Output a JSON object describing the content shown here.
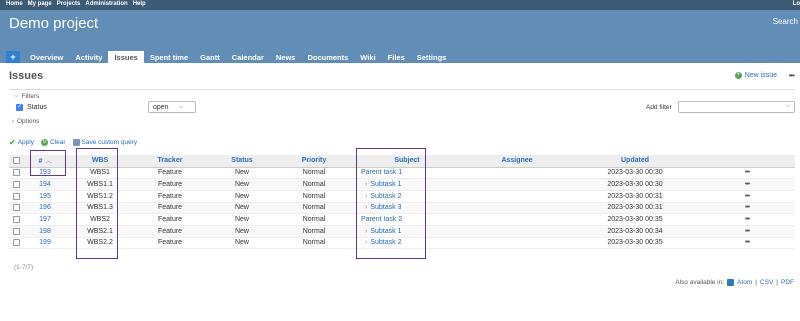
{
  "top_menu": {
    "items": [
      "Home",
      "My page",
      "Projects",
      "Administration",
      "Help"
    ],
    "right": "Lo"
  },
  "header": {
    "title": "Demo project",
    "search_label": "Search"
  },
  "tabs": [
    {
      "label": "+"
    },
    {
      "label": "Overview"
    },
    {
      "label": "Activity"
    },
    {
      "label": "Issues",
      "selected": true
    },
    {
      "label": "Spent time"
    },
    {
      "label": "Gantt"
    },
    {
      "label": "Calendar"
    },
    {
      "label": "News"
    },
    {
      "label": "Documents"
    },
    {
      "label": "Wiki"
    },
    {
      "label": "Files"
    },
    {
      "label": "Settings"
    }
  ],
  "page": {
    "title": "Issues",
    "new_issue": "New issue",
    "more": "•••"
  },
  "filters": {
    "legend": "Filters",
    "status_label": "Status",
    "status_value": "open",
    "add_filter_label": "Add filter",
    "options_legend": "Options"
  },
  "actions": {
    "apply": "Apply",
    "clear": "Clear",
    "save": "Save custom query"
  },
  "table": {
    "headers": [
      "#",
      "WBS",
      "Tracker",
      "Status",
      "Priority",
      "Subject",
      "Assignee",
      "Updated"
    ],
    "rows": [
      {
        "id": "193",
        "wbs": "WBS1",
        "tracker": "Feature",
        "status": "New",
        "priority": "Normal",
        "subject": "Parent task 1",
        "child": false,
        "updated": "2023-03-30 00:30"
      },
      {
        "id": "194",
        "wbs": "WBS1.1",
        "tracker": "Feature",
        "status": "New",
        "priority": "Normal",
        "subject": "Subtask 1",
        "child": true,
        "updated": "2023-03-30 00:30"
      },
      {
        "id": "195",
        "wbs": "WBS1.2",
        "tracker": "Feature",
        "status": "New",
        "priority": "Normal",
        "subject": "Subtask 2",
        "child": true,
        "updated": "2023-03-30 00:31"
      },
      {
        "id": "196",
        "wbs": "WBS1.3",
        "tracker": "Feature",
        "status": "New",
        "priority": "Normal",
        "subject": "Subtask 3",
        "child": true,
        "updated": "2023-03-30 00:31"
      },
      {
        "id": "197",
        "wbs": "WBS2",
        "tracker": "Feature",
        "status": "New",
        "priority": "Normal",
        "subject": "Parent task 2",
        "child": false,
        "updated": "2023-03-30 00:35"
      },
      {
        "id": "198",
        "wbs": "WBS2.1",
        "tracker": "Feature",
        "status": "New",
        "priority": "Normal",
        "subject": "Subtask 1",
        "child": true,
        "updated": "2023-03-30 00:34"
      },
      {
        "id": "199",
        "wbs": "WBS2.2",
        "tracker": "Feature",
        "status": "New",
        "priority": "Normal",
        "subject": "Subtask 2",
        "child": true,
        "updated": "2023-03-30 00:35"
      }
    ],
    "row_menu": "•••"
  },
  "pagination": "(1-7/7)",
  "footer": {
    "label": "Also available in:",
    "formats": [
      "Atom",
      "CSV",
      "PDF"
    ]
  }
}
